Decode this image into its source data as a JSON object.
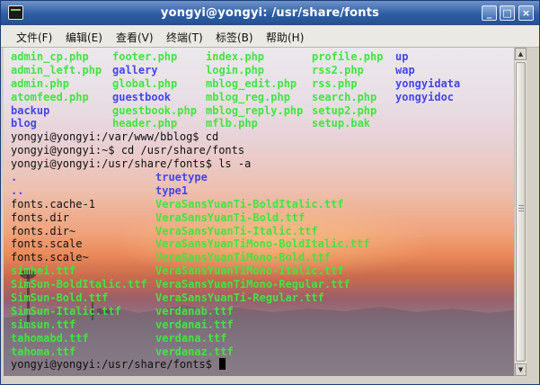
{
  "window": {
    "title": "yongyi@yongyi: /usr/share/fonts",
    "min_glyph": "_",
    "max_glyph": "□",
    "close_glyph": "×"
  },
  "menu": [
    "文件(F)",
    "编辑(E)",
    "查看(V)",
    "终端(T)",
    "标签(B)",
    "帮助(H)"
  ],
  "colors": {
    "dir_color": "#3fe63f",
    "file_color": "#4545ee",
    "text_color": "#101010",
    "titlebar": "#2e5da3"
  },
  "terminal": {
    "lines": [
      [
        [
          "admin_cp.php",
          "green"
        ],
        [
          "footer.php",
          "green"
        ],
        [
          "index.php",
          "green"
        ],
        [
          "profile.php",
          "green"
        ],
        [
          "up",
          "blue"
        ]
      ],
      [
        [
          "admin_left.php",
          "green"
        ],
        [
          "gallery",
          "blue"
        ],
        [
          "login.php",
          "green"
        ],
        [
          "rss2.php",
          "green"
        ],
        [
          "wap",
          "blue"
        ]
      ],
      [
        [
          "admin.php",
          "green"
        ],
        [
          "global.php",
          "green"
        ],
        [
          "mblog_edit.php",
          "green"
        ],
        [
          "rss.php",
          "green"
        ],
        [
          "yongyidata",
          "blue"
        ]
      ],
      [
        [
          "atomfeed.php",
          "green"
        ],
        [
          "guestbook",
          "blue"
        ],
        [
          "mblog_reg.php",
          "green"
        ],
        [
          "search.php",
          "green"
        ],
        [
          "yongyidoc",
          "blue"
        ]
      ],
      [
        [
          "backup",
          "blue"
        ],
        [
          "guestbook.php",
          "green"
        ],
        [
          "mblog_reply.php",
          "green"
        ],
        [
          "setup2.php",
          "green"
        ]
      ],
      [
        [
          "blog",
          "blue"
        ],
        [
          "header.php",
          "green"
        ],
        [
          "mflb.php",
          "green"
        ],
        [
          "setup.bak",
          "green"
        ]
      ],
      [
        [
          "yongyi@yongyi:/var/www/bblog$ cd",
          "plain"
        ]
      ],
      [
        [
          "yongyi@yongyi:~$ cd /usr/share/fonts",
          "plain"
        ]
      ],
      [
        [
          "yongyi@yongyi:/usr/share/fonts$ ls -a",
          "plain"
        ]
      ],
      [
        [
          ".",
          "blue"
        ],
        [
          "truetype",
          "blue"
        ]
      ],
      [
        [
          "..",
          "blue"
        ],
        [
          "type1",
          "blue"
        ]
      ],
      [
        [
          "fonts.cache-1",
          "plain"
        ],
        [
          "VeraSansYuanTi-BoldItalic.ttf",
          "green"
        ]
      ],
      [
        [
          "fonts.dir",
          "plain"
        ],
        [
          "VeraSansYuanTi-Bold.ttf",
          "green"
        ]
      ],
      [
        [
          "fonts.dir~",
          "plain"
        ],
        [
          "VeraSansYuanTi-Italic.ttf",
          "green"
        ]
      ],
      [
        [
          "fonts.scale",
          "plain"
        ],
        [
          "VeraSansYuanTiMono-BoldItalic.ttf",
          "green"
        ]
      ],
      [
        [
          "fonts.scale~",
          "plain"
        ],
        [
          "VeraSansYuanTiMono-Bold.ttf",
          "green"
        ]
      ],
      [
        [
          "simhei.ttf",
          "green"
        ],
        [
          "VeraSansYuanTiMono-Italic.ttf",
          "green"
        ]
      ],
      [
        [
          "SimSun-BoldItalic.ttf",
          "green"
        ],
        [
          "VeraSansYuanTiMono-Regular.ttf",
          "green"
        ]
      ],
      [
        [
          "SimSun-Bold.ttf",
          "green"
        ],
        [
          "VeraSansYuanTi-Regular.ttf",
          "green"
        ]
      ],
      [
        [
          "SimSun-Italic.ttf",
          "green"
        ],
        [
          "verdanab.ttf",
          "green"
        ]
      ],
      [
        [
          "simsun.ttf",
          "green"
        ],
        [
          "verdanai.ttf",
          "green"
        ]
      ],
      [
        [
          "tahomabd.ttf",
          "green"
        ],
        [
          "verdana.ttf",
          "green"
        ]
      ],
      [
        [
          "tahoma.ttf",
          "green"
        ],
        [
          "verdanaz.ttf",
          "green"
        ]
      ]
    ],
    "prompt": "yongyi@yongyi:/usr/share/fonts$ "
  }
}
